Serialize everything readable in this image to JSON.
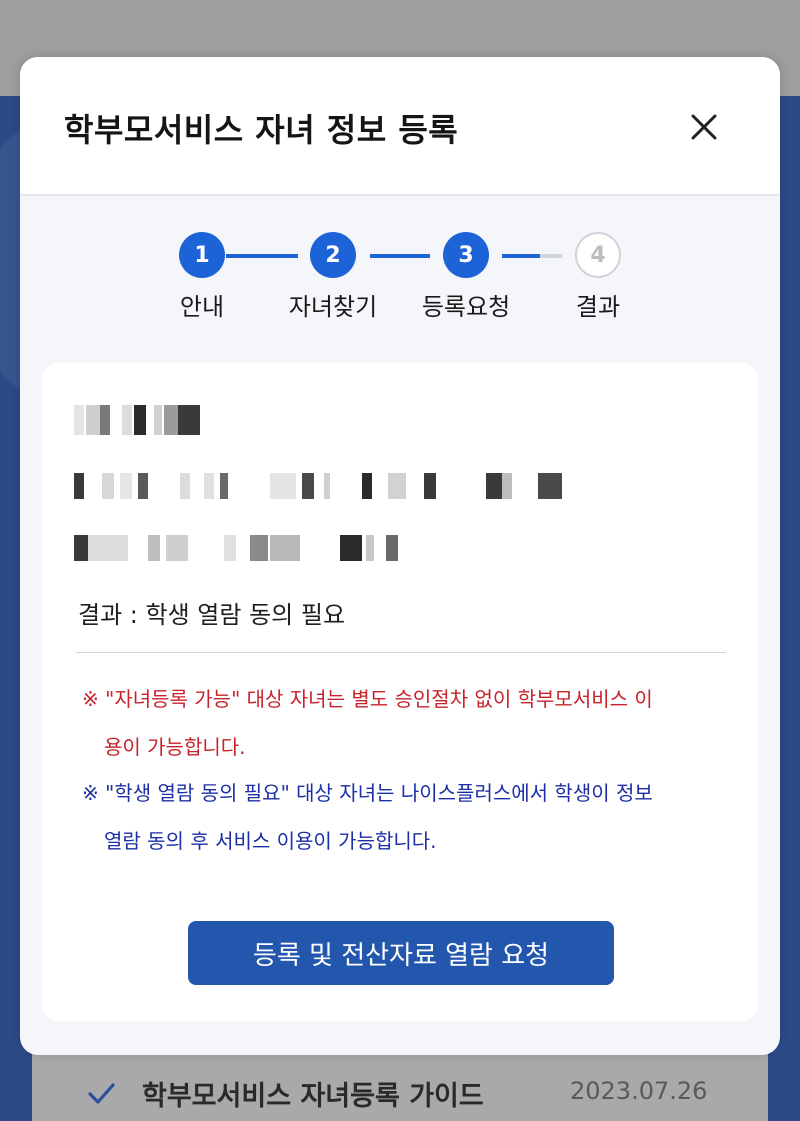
{
  "modal": {
    "title": "학부모서비스 자녀 정보 등록",
    "close_icon": "close-icon"
  },
  "stepper": {
    "steps": [
      {
        "number": "1",
        "label": "안내",
        "state": "done"
      },
      {
        "number": "2",
        "label": "자녀찾기",
        "state": "done"
      },
      {
        "number": "3",
        "label": "등록요청",
        "state": "current"
      },
      {
        "number": "4",
        "label": "결과",
        "state": "todo"
      }
    ],
    "active_color": "#1d63d8",
    "inactive_color": "#cfd3da"
  },
  "card": {
    "result_text": "결과 : 학생 열람 동의 필요",
    "notes": {
      "red_line1": "※ \"자녀등록 가능\" 대상 자녀는 별도 승인절차 없이 학부모서비스 이",
      "red_line2": "용이 가능합니다.",
      "blue_line1": "※ \"학생 열람 동의 필요\" 대상 자녀는 나이스플러스에서 학생이 정보",
      "blue_line2": "열람 동의 후 서비스 이용이 가능합니다."
    },
    "action_button": "등록 및 전산자료 열람 요청"
  },
  "background": {
    "guide_title": "학부모서비스 자녀등록 가이드",
    "guide_date": "2023.07.26",
    "check_icon": "check-icon"
  },
  "colors": {
    "red_note": "#c8232b",
    "blue_note": "#1c2fa6",
    "button_bg": "#2356ad",
    "page_blue": "#2b4a86"
  }
}
